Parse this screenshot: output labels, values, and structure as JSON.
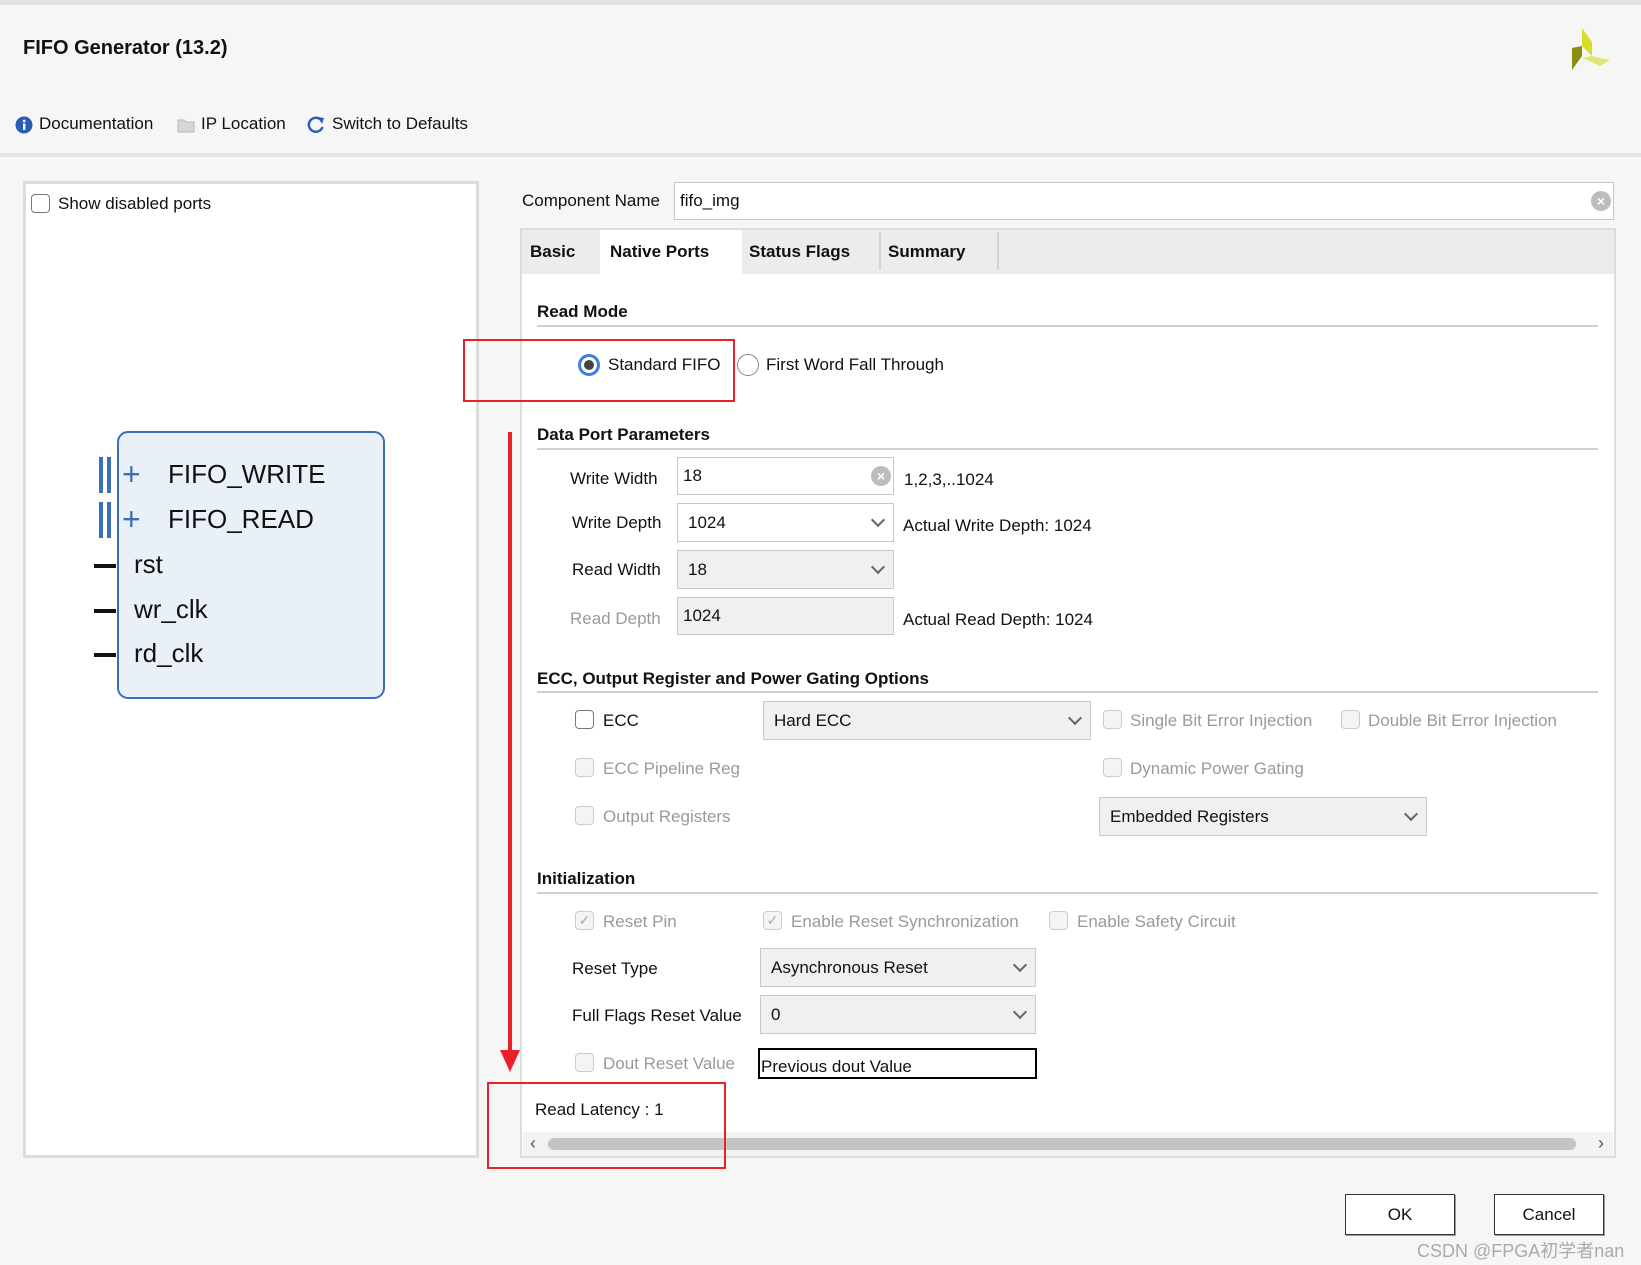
{
  "window": {
    "title": "FIFO Generator (13.2)",
    "logo": "xilinx-vivado-logo"
  },
  "toolbar": {
    "documentation": "Documentation",
    "ip_location": "IP Location",
    "switch_defaults": "Switch to Defaults"
  },
  "left": {
    "show_disabled_ports": "Show disabled ports",
    "ports": {
      "fifo_write": "FIFO_WRITE",
      "fifo_read": "FIFO_READ",
      "rst": "rst",
      "wr_clk": "wr_clk",
      "rd_clk": "rd_clk"
    }
  },
  "component": {
    "label": "Component Name",
    "value": "fifo_img"
  },
  "tabs": [
    {
      "label": "Basic"
    },
    {
      "label": "Native Ports",
      "selected": true
    },
    {
      "label": "Status Flags"
    },
    {
      "label": "Summary"
    }
  ],
  "read_mode": {
    "title": "Read Mode",
    "standard": "Standard FIFO",
    "fwft": "First Word Fall Through",
    "selected": "Standard FIFO"
  },
  "data_port": {
    "title": "Data Port Parameters",
    "write_width": {
      "label": "Write Width",
      "value": "18",
      "range": "1,2,3,..1024"
    },
    "write_depth": {
      "label": "Write Depth",
      "value": "1024",
      "actual": "Actual Write Depth: 1024"
    },
    "read_width": {
      "label": "Read Width",
      "value": "18"
    },
    "read_depth": {
      "label": "Read Depth",
      "value": "1024",
      "actual": "Actual Read Depth: 1024"
    }
  },
  "ecc": {
    "title": "ECC, Output Register and Power Gating Options",
    "ecc": "ECC",
    "ecc_type": "Hard ECC",
    "single_bit": "Single Bit Error Injection",
    "double_bit": "Double Bit Error Injection",
    "pipeline": "ECC Pipeline Reg",
    "dynamic_power": "Dynamic Power Gating",
    "output_regs": "Output Registers",
    "output_reg_type": "Embedded Registers"
  },
  "init": {
    "title": "Initialization",
    "reset_pin": "Reset Pin",
    "reset_sync": "Enable Reset Synchronization",
    "safety": "Enable Safety Circuit",
    "reset_type_label": "Reset Type",
    "reset_type": "Asynchronous Reset",
    "full_flags_label": "Full Flags Reset Value",
    "full_flags": "0",
    "dout_label": "Dout Reset Value",
    "dout_value": "Previous dout Value"
  },
  "read_latency": "Read Latency : 1",
  "buttons": {
    "ok": "OK",
    "cancel": "Cancel"
  },
  "watermark": "CSDN @FPGA初学者nan",
  "colors": {
    "annotation": "#e8212b",
    "accent": "#3d6fb8"
  }
}
